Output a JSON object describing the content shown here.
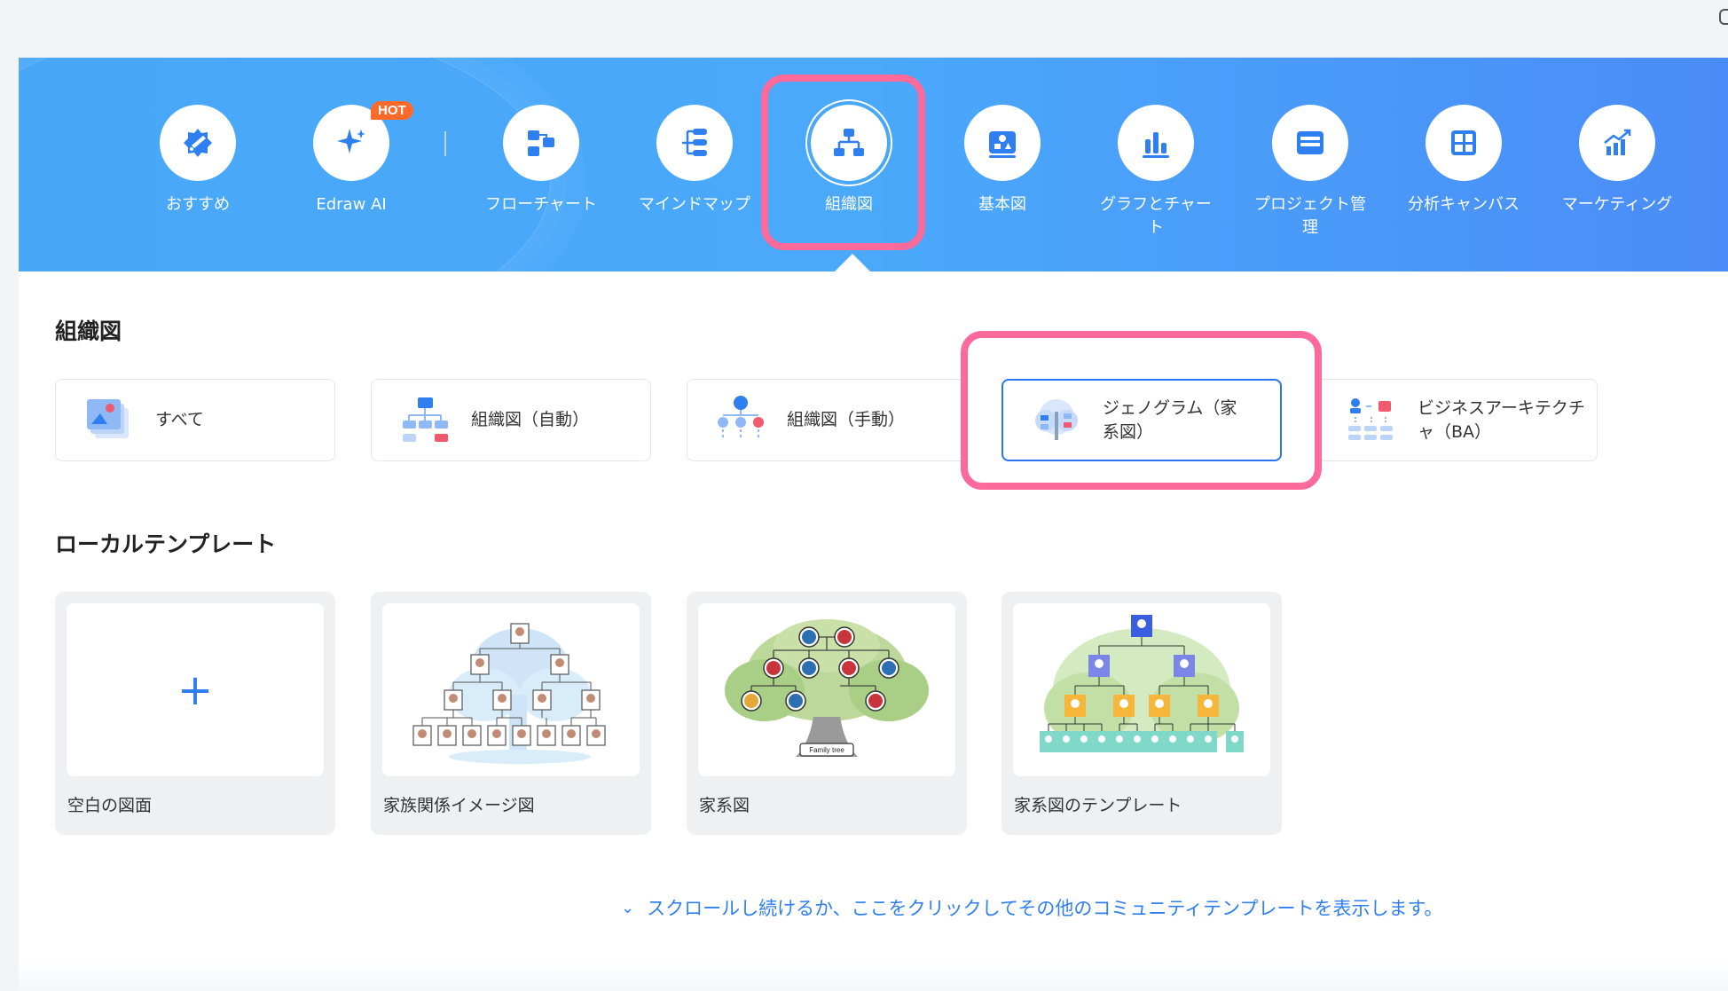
{
  "header": {
    "hot_badge": "HOT",
    "categories": [
      {
        "label": "おすすめ",
        "icon": "recommend-icon"
      },
      {
        "label": "Edraw AI",
        "icon": "ai-sparkle-icon"
      },
      {
        "label": "フローチャート",
        "icon": "flowchart-icon"
      },
      {
        "label": "マインドマップ",
        "icon": "mindmap-icon"
      },
      {
        "label": "組織図",
        "icon": "org-chart-icon"
      },
      {
        "label": "基本図",
        "icon": "basic-diagram-icon"
      },
      {
        "label": "グラフとチャート",
        "icon": "bar-chart-icon"
      },
      {
        "label": "プロジェクト管理",
        "icon": "project-icon"
      },
      {
        "label": "分析キャンバス",
        "icon": "canvas-icon"
      },
      {
        "label": "マーケティング",
        "icon": "marketing-icon"
      }
    ],
    "selected_category": "組織図"
  },
  "org_section": {
    "title": "組織図",
    "subcategories": [
      {
        "label": "すべて"
      },
      {
        "label": "組織図（自動）"
      },
      {
        "label": "組織図（手動）"
      },
      {
        "label": "ジェノグラム（家系図）"
      },
      {
        "label": "ビジネスアーキテクチャ（BA）"
      }
    ],
    "selected_subcategory": "ジェノグラム（家系図）"
  },
  "local_templates": {
    "title": "ローカルテンプレート",
    "items": [
      {
        "name": "空白の図面",
        "plus": "+"
      },
      {
        "name": "家族関係イメージ図"
      },
      {
        "name": "家系図",
        "badge": "Family tree"
      },
      {
        "name": "家系図のテンプレート"
      }
    ]
  },
  "more_link": {
    "chevron": "⌄",
    "text": "スクロールし続けるか、ここをクリックしてその他のコミュニティテンプレートを表示します。"
  },
  "colors": {
    "banner_start": "#49a7f8",
    "banner_end": "#4a8cf7",
    "accent": "#2f7ff0",
    "highlight": "#fb6a9b",
    "hot": "#ff6a2b"
  }
}
